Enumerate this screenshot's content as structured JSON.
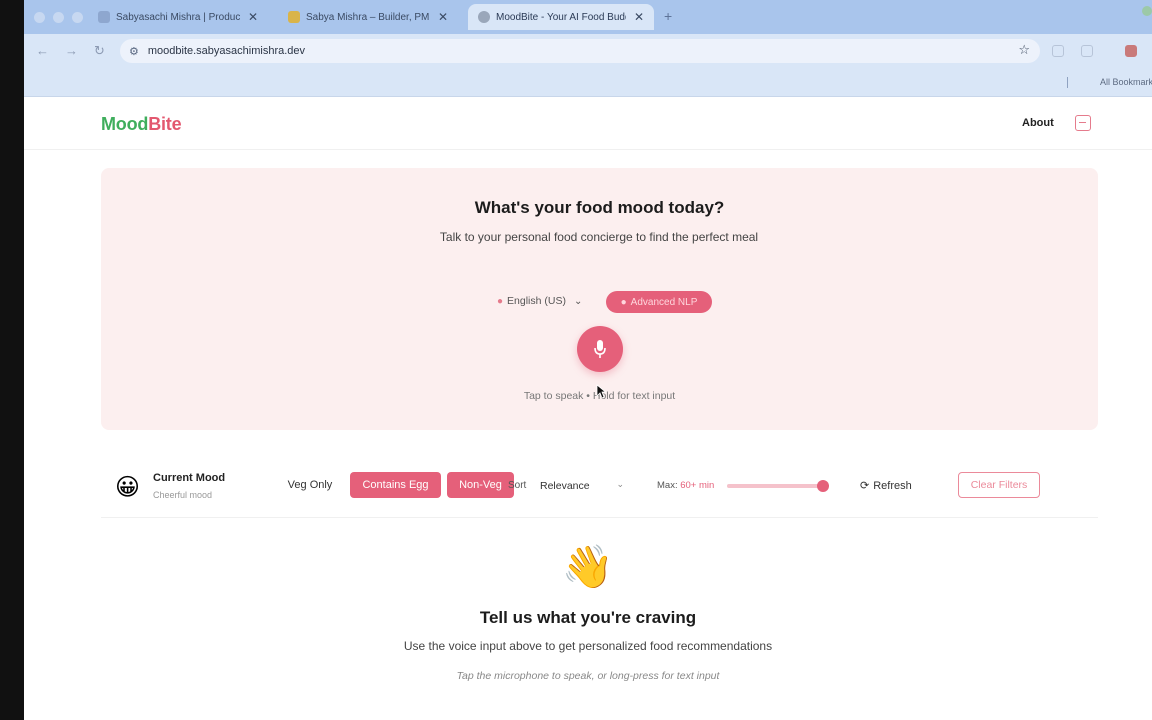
{
  "browser": {
    "tabs": [
      {
        "title": "Sabyasachi Mishra | Product"
      },
      {
        "title": "Sabya Mishra – Builder, PM"
      },
      {
        "title": "MoodBite - Your AI Food Buddy"
      }
    ],
    "url": "moodbite.sabyasachimishra.dev",
    "bookmarks_label": "All Bookmarks"
  },
  "header": {
    "logo_part1": "Mood",
    "logo_part2": "Bite",
    "about": "About"
  },
  "hero": {
    "title": "What's your food mood today?",
    "subtitle": "Talk to your personal food concierge to find the perfect meal",
    "language": "English (US)",
    "nlp_label": "Advanced NLP",
    "hint": "Tap to speak • Hold for text input"
  },
  "filters": {
    "mood_emoji": "😀",
    "mood_title": "Current Mood",
    "mood_value": "Cheerful mood",
    "veg": "Veg Only",
    "egg": "Contains Egg",
    "nonveg": "Non-Veg",
    "sort_label": "Sort",
    "sort_value": "Relevance",
    "max_label": "Max:",
    "max_value": "60+ min",
    "max_level_fraction": 0.96,
    "refresh": "Refresh",
    "clear": "Clear Filters"
  },
  "empty_state": {
    "emoji": "👋",
    "title": "Tell us what you're craving",
    "subtitle": "Use the voice input above to get personalized food recommendations",
    "hint": "Tap the microphone to speak, or long-press for text input"
  },
  "colors": {
    "brand_green": "#3fae5d",
    "brand_pink": "#e5607a"
  }
}
